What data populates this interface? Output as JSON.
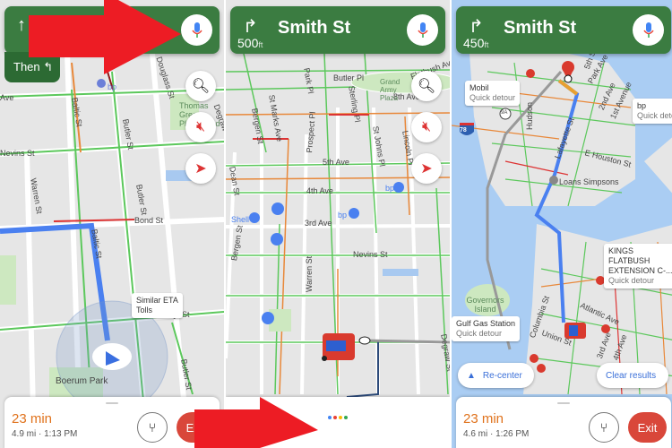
{
  "colors": {
    "nav_green": "#3b7c41",
    "then_green": "#2c6a33",
    "route_blue": "#4a80f0",
    "eta_orange": "#e0721c",
    "exit_red": "#d9473a",
    "arrow_red": "#ed1c24"
  },
  "panel1": {
    "header": {
      "turn_icon": "straight-arrow-icon",
      "then_label": "Then",
      "then_icon": "turn-left-icon"
    },
    "streets": [
      "Baltic St",
      "Butler St",
      "Nevins St",
      "Warren St",
      "Bond St",
      "Hoyt St",
      "Butler St",
      "Douglass St",
      "Degraw St",
      "Ave"
    ],
    "places": [
      "Thomas Greene Playground",
      "Boerum Park",
      "Douglass Degraw Pool"
    ],
    "poi": "bp",
    "callout": {
      "title": "Similar ETA",
      "sub": "Tolls"
    },
    "sheet": {
      "eta": "23 min",
      "details": "4.9 mi · 1:13 PM",
      "exit": "Exit"
    }
  },
  "panel2": {
    "header": {
      "distance": "500",
      "unit": "ft",
      "street": "Smith St"
    },
    "streets": [
      "5th Ave",
      "4th Ave",
      "3rd Ave",
      "Nevins St",
      "Dean St",
      "Bergen St",
      "Bergen St",
      "Warren St",
      "St Marks Ave",
      "Prospect Pl",
      "Park Pl",
      "Sterling Pl",
      "St Johns Pl",
      "Lincoln Pl",
      "8th Ave",
      "Flatbush Ave",
      "Butler Pl",
      "Degraw St"
    ],
    "places": [
      "Grand Army Plaza"
    ],
    "pois": [
      "Shell",
      "bp",
      "bp"
    ]
  },
  "panel3": {
    "header": {
      "distance": "450",
      "unit": "ft",
      "street": "Smith St"
    },
    "callouts": [
      {
        "title": "Mobil",
        "sub": "Quick detour"
      },
      {
        "title": "bp",
        "sub": "Quick detour"
      },
      {
        "title": "KINGS FLATBUSH EXTENSION C-...",
        "sub": "Quick detour"
      },
      {
        "title": "Gulf Gas Station",
        "sub": "Quick detour"
      }
    ],
    "streets": [
      "Hudson",
      "Lafayette St",
      "2nd Ave",
      "1st Avenue",
      "E Houston St",
      "Atlantic Ave",
      "Columbia St",
      "Union St",
      "3rd Ave",
      "4th Ave",
      "5th St",
      "Park Ave S"
    ],
    "places": [
      "Loans Simpsons",
      "Governors Island"
    ],
    "shields": [
      "9A",
      "78"
    ],
    "recenter": "Re-center",
    "clear": "Clear results",
    "sheet": {
      "eta": "23 min",
      "details": "4.6 mi · 1:26 PM",
      "exit": "Exit"
    }
  }
}
